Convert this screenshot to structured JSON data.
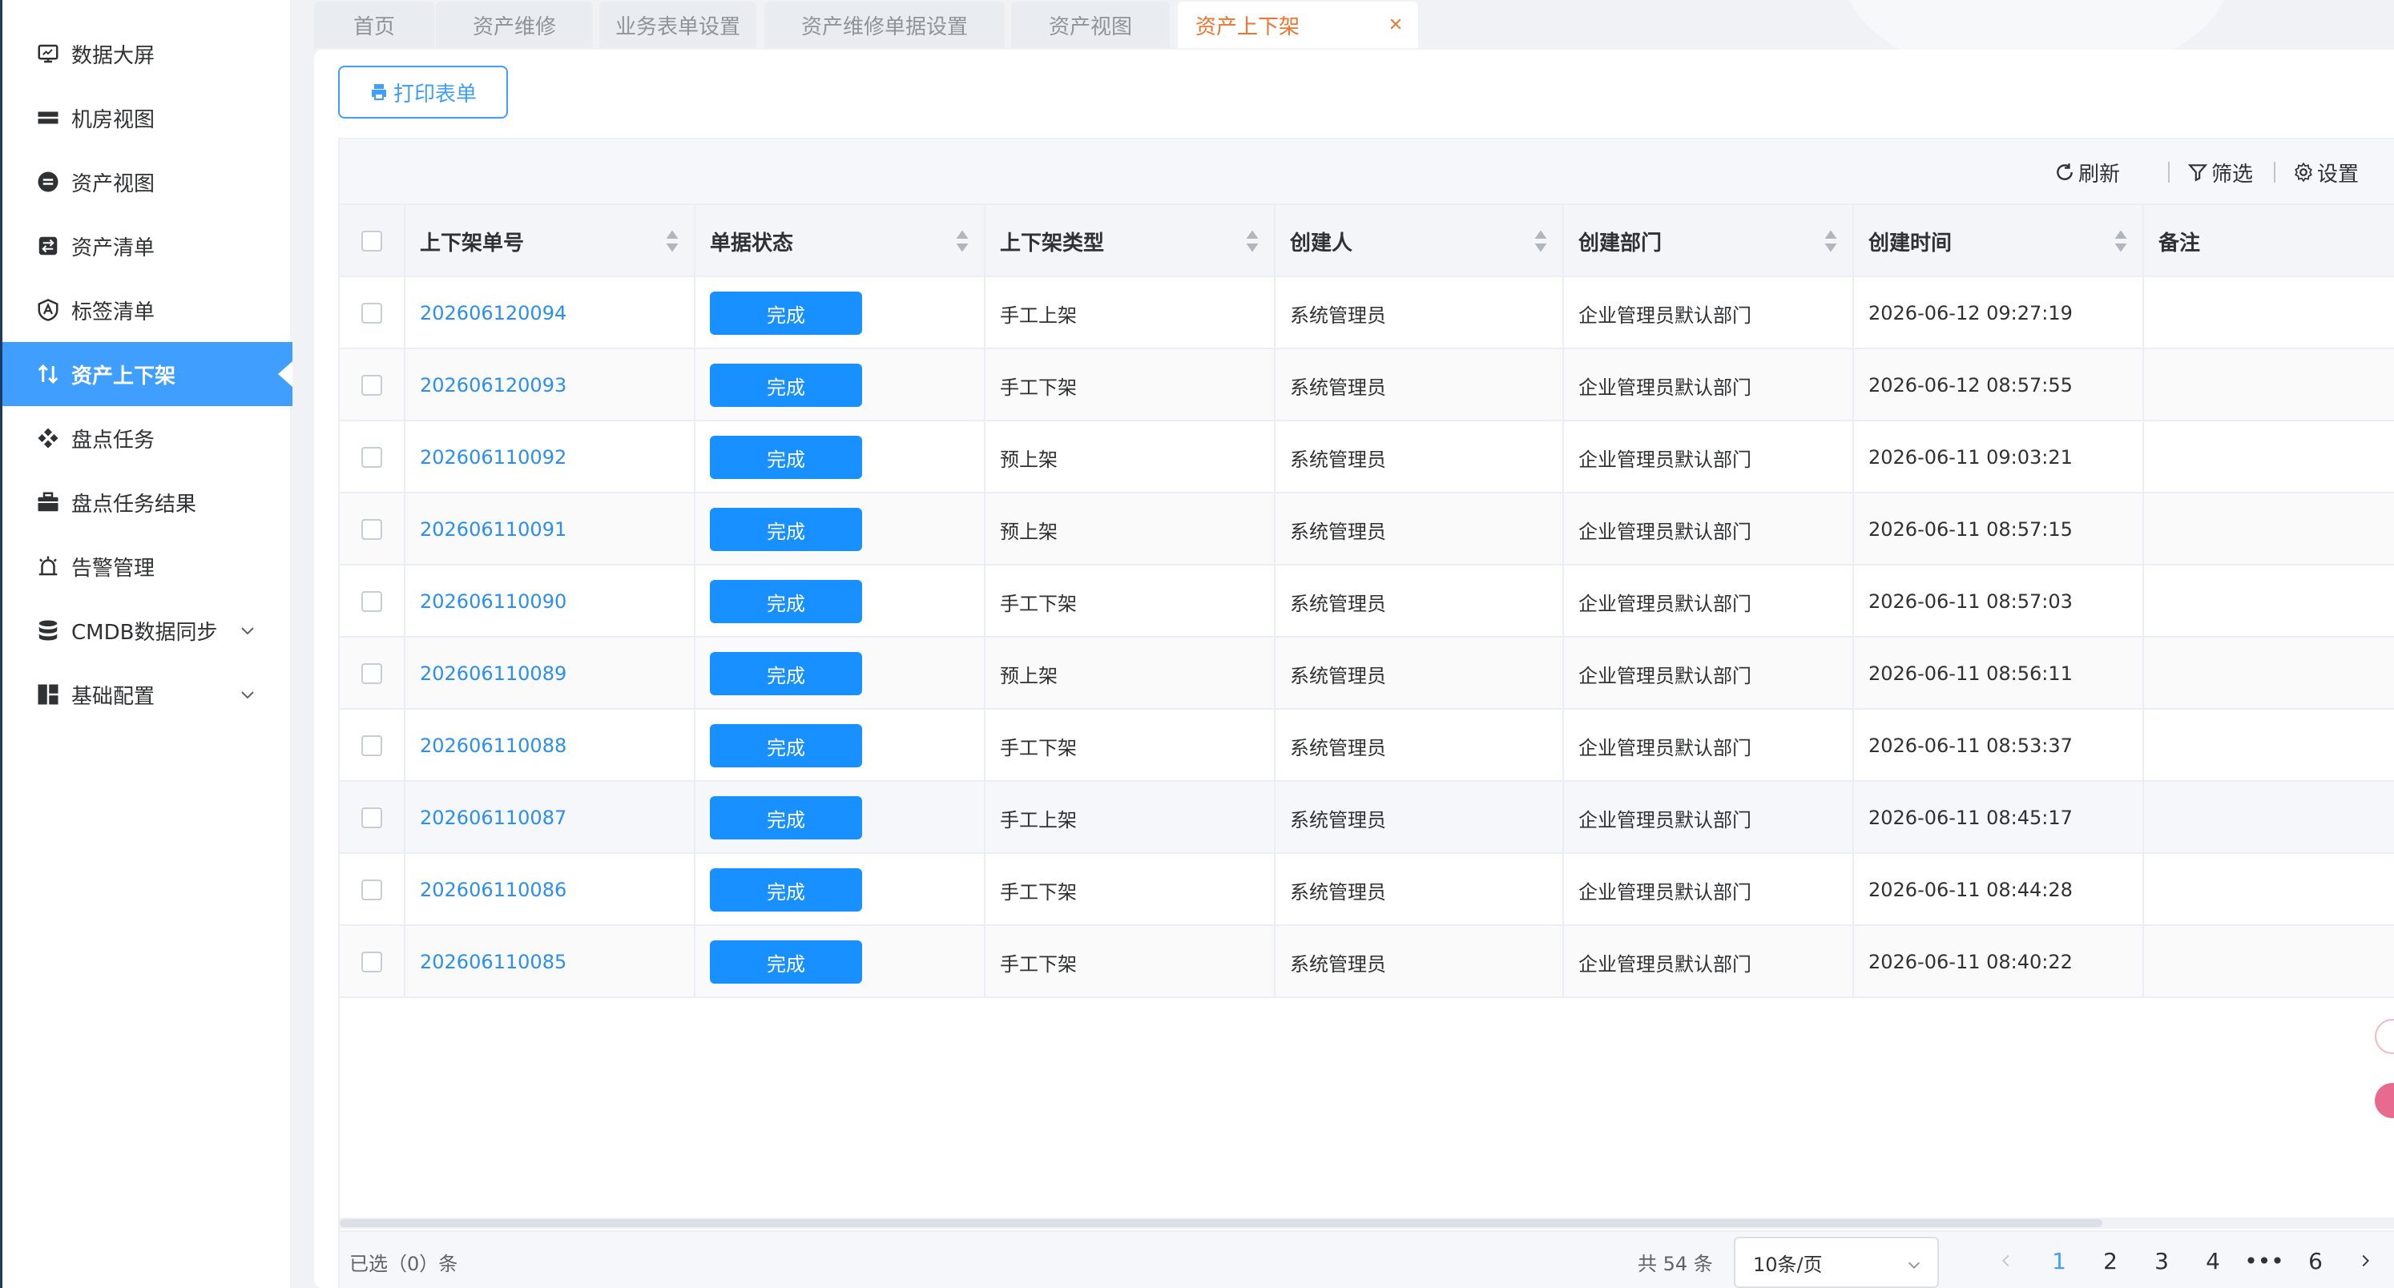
{
  "sidebar": {
    "items": [
      {
        "label": "数据大屏",
        "icon": "monitor-icon"
      },
      {
        "label": "机房视图",
        "icon": "server-room-icon"
      },
      {
        "label": "资产视图",
        "icon": "asset-view-icon"
      },
      {
        "label": "资产清单",
        "icon": "asset-list-icon"
      },
      {
        "label": "标签清单",
        "icon": "tag-shield-icon"
      },
      {
        "label": "资产上下架",
        "icon": "up-down-arrows-icon"
      },
      {
        "label": "盘点任务",
        "icon": "inventory-task-icon"
      },
      {
        "label": "盘点任务结果",
        "icon": "briefcase-icon"
      },
      {
        "label": "告警管理",
        "icon": "alarm-icon"
      },
      {
        "label": "CMDB数据同步",
        "icon": "database-icon"
      },
      {
        "label": "基础配置",
        "icon": "config-icon"
      }
    ],
    "active_index": 5
  },
  "tabs": {
    "items": [
      "首页",
      "资产维修",
      "业务表单设置",
      "资产维修单据设置",
      "资产视图",
      "资产上下架"
    ],
    "active_index": 5
  },
  "toolbar": {
    "print_label": "打印表单",
    "refresh_label": "刷新",
    "filter_label": "筛选",
    "settings_label": "设置"
  },
  "table": {
    "columns": [
      "上下架单号",
      "单据状态",
      "上下架类型",
      "创建人",
      "创建部门",
      "创建时间",
      "备注"
    ],
    "rows": [
      {
        "id": "202606120094",
        "status": "完成",
        "type": "手工上架",
        "creator": "系统管理员",
        "dept": "企业管理员默认部门",
        "time": "2026-06-12 09:27:19",
        "note": ""
      },
      {
        "id": "202606120093",
        "status": "完成",
        "type": "手工下架",
        "creator": "系统管理员",
        "dept": "企业管理员默认部门",
        "time": "2026-06-12 08:57:55",
        "note": ""
      },
      {
        "id": "202606110092",
        "status": "完成",
        "type": "预上架",
        "creator": "系统管理员",
        "dept": "企业管理员默认部门",
        "time": "2026-06-11 09:03:21",
        "note": ""
      },
      {
        "id": "202606110091",
        "status": "完成",
        "type": "预上架",
        "creator": "系统管理员",
        "dept": "企业管理员默认部门",
        "time": "2026-06-11 08:57:15",
        "note": ""
      },
      {
        "id": "202606110090",
        "status": "完成",
        "type": "手工下架",
        "creator": "系统管理员",
        "dept": "企业管理员默认部门",
        "time": "2026-06-11 08:57:03",
        "note": ""
      },
      {
        "id": "202606110089",
        "status": "完成",
        "type": "预上架",
        "creator": "系统管理员",
        "dept": "企业管理员默认部门",
        "time": "2026-06-11 08:56:11",
        "note": ""
      },
      {
        "id": "202606110088",
        "status": "完成",
        "type": "手工下架",
        "creator": "系统管理员",
        "dept": "企业管理员默认部门",
        "time": "2026-06-11 08:53:37",
        "note": ""
      },
      {
        "id": "202606110087",
        "status": "完成",
        "type": "手工上架",
        "creator": "系统管理员",
        "dept": "企业管理员默认部门",
        "time": "2026-06-11 08:45:17",
        "note": ""
      },
      {
        "id": "202606110086",
        "status": "完成",
        "type": "手工下架",
        "creator": "系统管理员",
        "dept": "企业管理员默认部门",
        "time": "2026-06-11 08:44:28",
        "note": ""
      },
      {
        "id": "202606110085",
        "status": "完成",
        "type": "手工下架",
        "creator": "系统管理员",
        "dept": "企业管理员默认部门",
        "time": "2026-06-11 08:40:22",
        "note": ""
      }
    ]
  },
  "footer": {
    "selected_text": "已选（0）条",
    "total_text": "共 54 条",
    "page_size": "10条/页",
    "pages": [
      "1",
      "2",
      "3",
      "4",
      "•••",
      "6"
    ],
    "current_page": "1"
  },
  "colors": {
    "primary": "#409eff",
    "status_button": "#1890ff",
    "active_tab_text": "#f0732e",
    "link": "#2a8ff0"
  }
}
